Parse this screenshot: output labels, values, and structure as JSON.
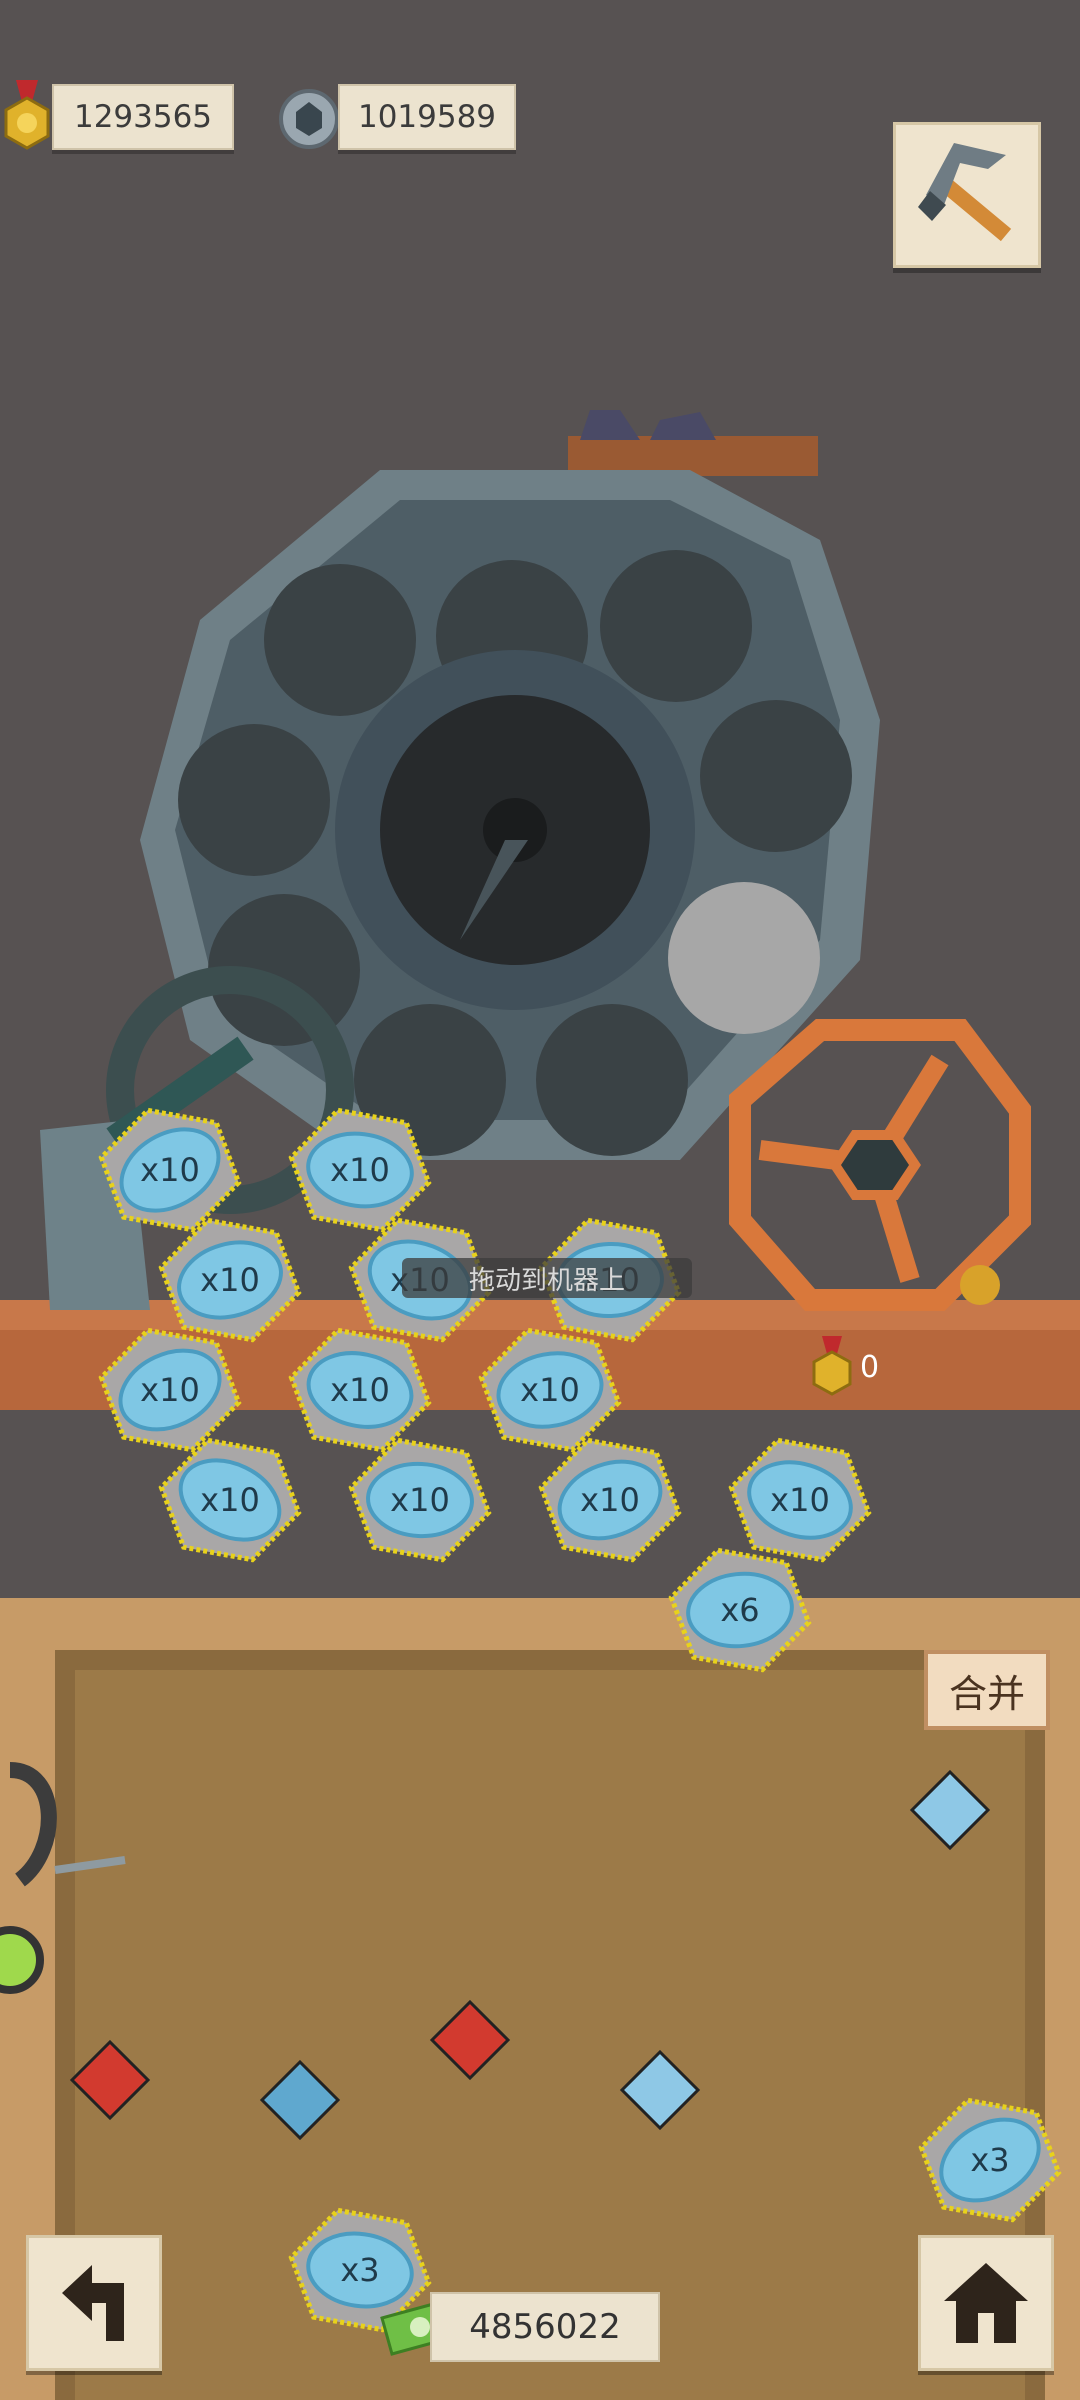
{
  "hud": {
    "gold_medals": "1293565",
    "gears": "1019589",
    "medal_reward_count": "0",
    "money": "4856022"
  },
  "machine": {
    "drag_hint": "拖动到机器上"
  },
  "actions": {
    "merge_label": "合并"
  },
  "ore_tiles": [
    {
      "label": "x10",
      "row": 0,
      "col": 0
    },
    {
      "label": "x10",
      "row": 0,
      "col": 1
    },
    {
      "label": "x10",
      "row": 1,
      "col": 0
    },
    {
      "label": "x10",
      "row": 1,
      "col": 1
    },
    {
      "label": "x10",
      "row": 1,
      "col": 2
    },
    {
      "label": "x10",
      "row": 2,
      "col": 0
    },
    {
      "label": "x10",
      "row": 2,
      "col": 1
    },
    {
      "label": "x10",
      "row": 2,
      "col": 2
    },
    {
      "label": "x10",
      "row": 3,
      "col": 0
    },
    {
      "label": "x10",
      "row": 3,
      "col": 1
    },
    {
      "label": "x10",
      "row": 3,
      "col": 2
    },
    {
      "label": "x10",
      "row": 3,
      "col": 3
    },
    {
      "label": "x6",
      "row": 4,
      "col": 3
    },
    {
      "label": "x3",
      "row": 9,
      "col": 4
    },
    {
      "label": "x3",
      "row": 10,
      "col": 1
    }
  ],
  "colors": {
    "background": "#575252",
    "floor": "#c79b67",
    "shelf": "#b7673c",
    "wheel": "#d9783b",
    "ore_label": "#7fc7e4",
    "selection_outline": "#e8d21b"
  },
  "icons": [
    "medal-icon",
    "gear-icon",
    "pickaxe-icon",
    "back-arrow-icon",
    "home-icon",
    "money-icon",
    "ruby-icon",
    "diamond-icon"
  ]
}
